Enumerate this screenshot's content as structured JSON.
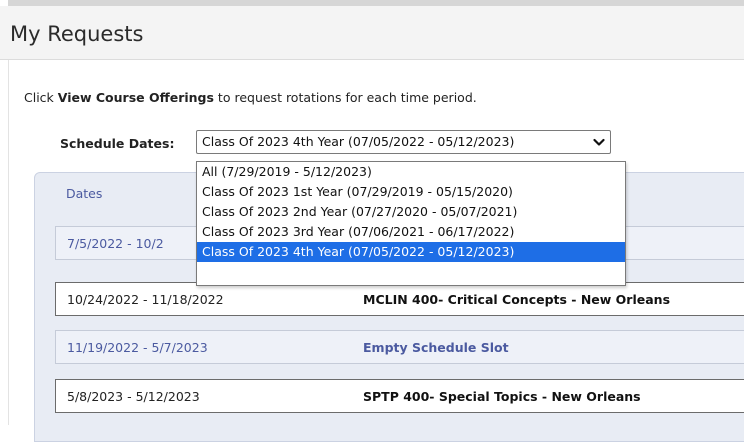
{
  "page": {
    "title": "My Requests"
  },
  "instruction": {
    "prefix": "Click ",
    "bold": "View Course Offerings",
    "suffix": " to request rotations for each time period."
  },
  "schedule": {
    "label": "Schedule Dates:",
    "selected": "Class Of 2023 4th Year (07/05/2022 - 05/12/2023)",
    "options": [
      "All (7/29/2019 - 5/12/2023)",
      "Class Of 2023 1st Year (07/29/2019 - 05/15/2020)",
      "Class Of 2023 2nd Year (07/27/2020 - 05/07/2021)",
      "Class Of 2023 3rd Year (07/06/2021 - 06/17/2022)",
      "Class Of 2023 4th Year (07/05/2022 - 05/12/2023)"
    ]
  },
  "table": {
    "dates_header": "Dates",
    "rows": [
      {
        "date": "7/5/2022 - 10/2",
        "course": ""
      },
      {
        "date": "10/24/2022 - 11/18/2022",
        "course": "MCLIN 400- Critical Concepts - New Orleans"
      },
      {
        "date": "11/19/2022 - 5/7/2023",
        "course": "Empty Schedule Slot"
      },
      {
        "date": "5/8/2023 - 5/12/2023",
        "course": "SPTP 400- Special Topics - New Orleans"
      }
    ]
  },
  "colors": {
    "selected_option": "#1e6ee6",
    "link_text": "#4b5aa0",
    "header_bg": "#f4f4f4"
  },
  "icons": {
    "select_arrow": "chevron-down-icon"
  }
}
